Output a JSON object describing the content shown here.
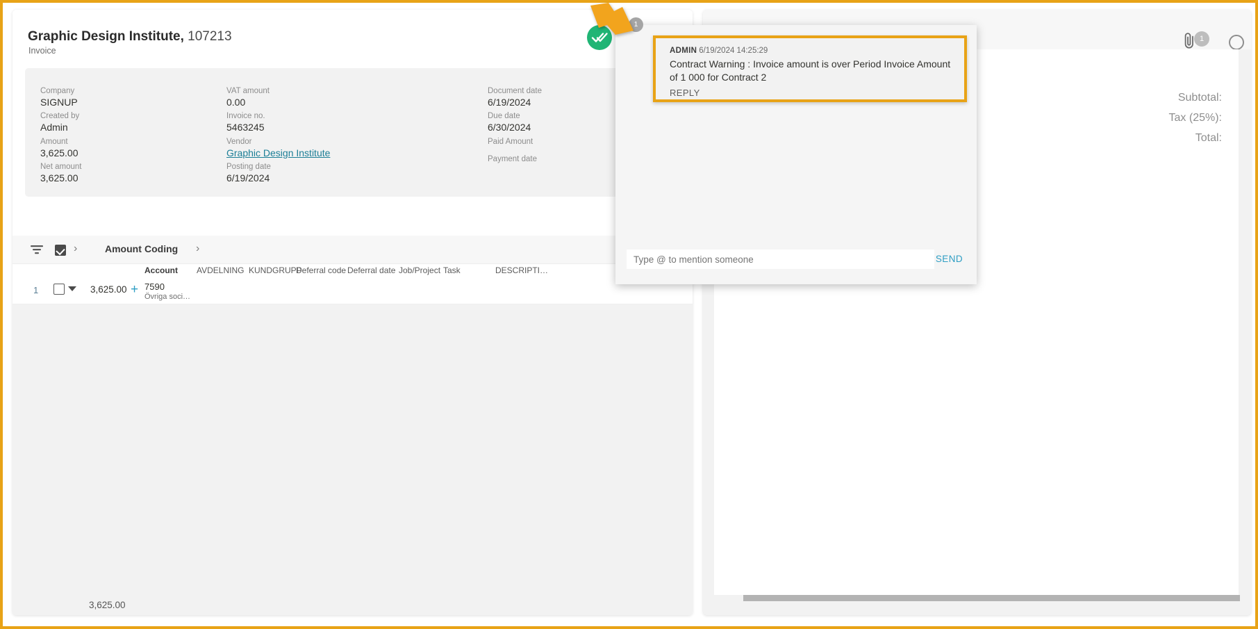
{
  "invoice": {
    "vendor_name": "Graphic Design Institute,",
    "doc_number": "107213",
    "doc_type": "Invoice",
    "fields": [
      {
        "label": "Company",
        "value": "SIGNUP"
      },
      {
        "label": "Created by",
        "value": "Admin"
      },
      {
        "label": "Amount",
        "value": "3,625.00"
      },
      {
        "label": "Net amount",
        "value": "3,625.00"
      },
      {
        "label": "VAT amount",
        "value": "0.00"
      },
      {
        "label": "Invoice no.",
        "value": "5463245"
      },
      {
        "label": "Vendor",
        "value": "Graphic Design Institute"
      },
      {
        "label": "Posting date",
        "value": "6/19/2024"
      },
      {
        "label": "Document date",
        "value": "6/19/2024"
      },
      {
        "label": "Due date",
        "value": "6/30/2024"
      },
      {
        "label": "Paid Amount",
        "value": ""
      },
      {
        "label": "Payment date",
        "value": ""
      }
    ]
  },
  "coding": {
    "toolbar": {
      "filter_icon": "filter-icon",
      "select_all_checkbox": "checked",
      "expand_icon": "chevron-right-icon",
      "amount_header": "Amount",
      "coding_header": "Coding",
      "coding_expand_icon": "chevron-right-icon"
    },
    "columns": [
      "Account",
      "AVDELNING",
      "KUNDGRUPP",
      "Deferral code",
      "Deferral date",
      "Job/Project",
      "Task",
      "DESCRIPTI…"
    ],
    "row": {
      "number": "1",
      "amount": "3,625.00",
      "add_icon": "plus-icon",
      "account_code": "7590",
      "account_desc": "Övriga soci…"
    },
    "footer_total": "3,625.00"
  },
  "comments": {
    "badge_count": "1",
    "entry": {
      "author": "ADMIN",
      "timestamp": "6/19/2024 14:25:29",
      "text": "Contract Warning : Invoice amount is over Period Invoice Amount of 1 000 for Contract 2",
      "reply_label": "REPLY"
    },
    "input_placeholder": "Type @ to mention someone",
    "send_label": "SEND"
  },
  "document_preview": {
    "attachment_icon": "paperclip-icon",
    "attachment_count": "1",
    "more_icon": "circle-icon",
    "totals": [
      "Subtotal:",
      "Tax (25%):",
      "Total:"
    ]
  },
  "status": {
    "approved_icon": "double-check-icon"
  },
  "colors": {
    "accent_orange": "#e8a317",
    "link_teal": "#1b7e96",
    "action_blue": "#2e9ec4",
    "status_green": "#20b575"
  }
}
